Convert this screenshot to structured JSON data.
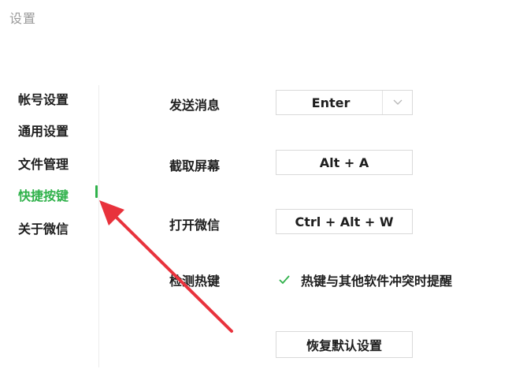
{
  "window": {
    "title": "设置"
  },
  "sidebar": {
    "items": [
      {
        "label": "帐号设置",
        "active": false
      },
      {
        "label": "通用设置",
        "active": false
      },
      {
        "label": "文件管理",
        "active": false
      },
      {
        "label": "快捷按键",
        "active": true
      },
      {
        "label": "关于微信",
        "active": false
      }
    ],
    "active_color": "#2fb14a"
  },
  "shortcuts": {
    "send_message": {
      "label": "发送消息",
      "value": "Enter"
    },
    "screenshot": {
      "label": "截取屏幕",
      "value": "Alt + A"
    },
    "open_wechat": {
      "label": "打开微信",
      "value": "Ctrl + Alt + W"
    },
    "detect_hotkey": {
      "label": "检测热键",
      "checkbox_label": "热键与其他软件冲突时提醒",
      "checked": true
    }
  },
  "reset_button": {
    "label": "恢复默认设置"
  },
  "annotation": {
    "arrow_color": "#e8323c"
  }
}
